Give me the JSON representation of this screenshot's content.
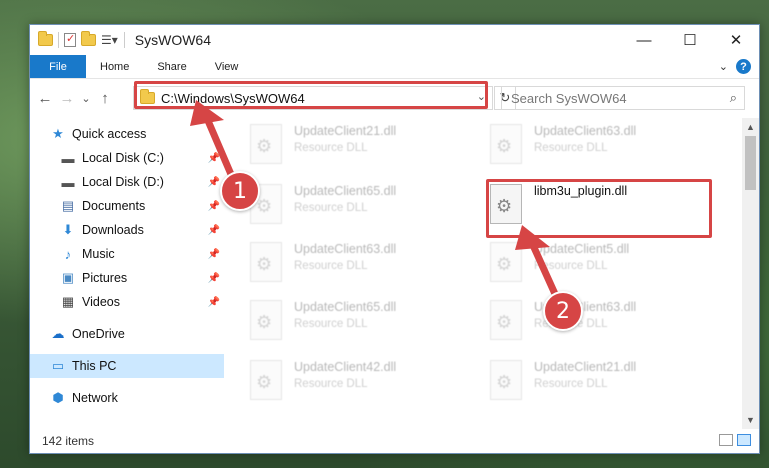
{
  "window": {
    "title": "SysWOW64"
  },
  "titlebar_buttons": {
    "minimize": "—",
    "maximize": "☐",
    "close": "✕"
  },
  "ribbon": {
    "file": "File",
    "home": "Home",
    "share": "Share",
    "view": "View",
    "expand": "⌄",
    "help": "?"
  },
  "nav": {
    "back": "←",
    "forward": "→",
    "recent": "⌄",
    "up": "↑"
  },
  "address": {
    "path": "C:\\Windows\\SysWOW64",
    "dropdown": "⌄",
    "refresh": "↻"
  },
  "search": {
    "placeholder": "Search SysWOW64",
    "icon": "⌕"
  },
  "sidebar": {
    "items": [
      {
        "label": "Quick access",
        "icon": "★",
        "color": "#2f88d6",
        "pinned": false
      },
      {
        "label": "Local Disk (C:)",
        "icon": "▬",
        "color": "#555555",
        "pinned": true
      },
      {
        "label": "Local Disk (D:)",
        "icon": "▬",
        "color": "#555555",
        "pinned": true
      },
      {
        "label": "Documents",
        "icon": "▤",
        "color": "#4a6fa5",
        "pinned": true
      },
      {
        "label": "Downloads",
        "icon": "⬇",
        "color": "#2f88d6",
        "pinned": true
      },
      {
        "label": "Music",
        "icon": "♪",
        "color": "#2f88d6",
        "pinned": true
      },
      {
        "label": "Pictures",
        "icon": "▣",
        "color": "#4a8ac4",
        "pinned": true
      },
      {
        "label": "Videos",
        "icon": "▦",
        "color": "#444444",
        "pinned": true
      },
      {
        "label": "OneDrive",
        "icon": "☁",
        "color": "#1a6fc9",
        "pinned": false
      },
      {
        "label": "This PC",
        "icon": "▭",
        "color": "#2f88d6",
        "pinned": false
      },
      {
        "label": "Network",
        "icon": "⬢",
        "color": "#2f88d6",
        "pinned": false
      }
    ]
  },
  "files": {
    "left": [
      {
        "name": "UpdateClient21.dll",
        "type": "Resource DLL"
      },
      {
        "name": "UpdateClient65.dll",
        "type": "Resource DLL"
      },
      {
        "name": "UpdateClient63.dll",
        "type": "Resource DLL"
      },
      {
        "name": "UpdateClient65.dll",
        "type": "Resource DLL"
      },
      {
        "name": "UpdateClient42.dll",
        "type": "Resource DLL"
      }
    ],
    "right": [
      {
        "name": "UpdateClient63.dll",
        "type": "Resource DLL"
      },
      {
        "name": "libm3u_plugin.dll",
        "type": ""
      },
      {
        "name": "UpdateClient5.dll",
        "type": "Resource DLL"
      },
      {
        "name": "UpdateClient63.dll",
        "type": "Resource DLL"
      },
      {
        "name": "UpdateClient21.dll",
        "type": "Resource DLL"
      }
    ]
  },
  "status": {
    "count": "142 items"
  },
  "annotations": {
    "badge1": "1",
    "badge2": "2",
    "accent": "#d64545"
  }
}
